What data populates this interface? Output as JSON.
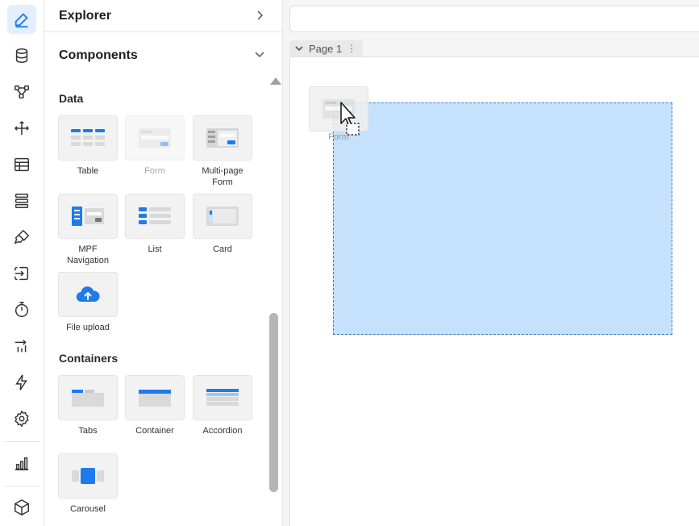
{
  "sidebar": {
    "items": [
      {
        "icon": "edit-icon",
        "active": true
      },
      {
        "icon": "database-icon"
      },
      {
        "icon": "workflow-icon"
      },
      {
        "icon": "move-icon"
      },
      {
        "icon": "table-icon"
      },
      {
        "icon": "list-rows-icon"
      },
      {
        "icon": "brush-icon"
      },
      {
        "icon": "import-export-icon"
      },
      {
        "icon": "timer-icon"
      },
      {
        "icon": "sort-icon"
      },
      {
        "icon": "lightning-icon"
      },
      {
        "icon": "settings-gear-icon"
      },
      {
        "icon": "bar-chart-icon"
      },
      {
        "icon": "cube-icon"
      }
    ],
    "accent": "#1f7aec"
  },
  "panel": {
    "explorer_title": "Explorer",
    "components_title": "Components",
    "data_section": "Data",
    "containers_section": "Containers",
    "data_tiles": [
      "Table",
      "Form",
      "Multi-page Form",
      "MPF Navigation",
      "List",
      "Card",
      "File upload"
    ],
    "container_tiles": [
      "Tabs",
      "Container",
      "Accordion",
      "Carousel"
    ]
  },
  "canvas": {
    "page_tab": "Page 1",
    "page_tab_menu": "⋮",
    "drag_ghost_label": "Form",
    "drop_zone_color": "#c5e1fb"
  }
}
